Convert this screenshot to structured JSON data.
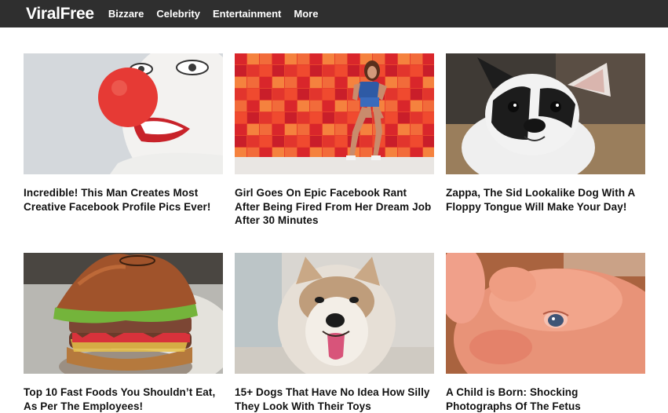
{
  "site": {
    "logo": "ViralFree",
    "nav": [
      "Bizzare",
      "Celebrity",
      "Entertainment",
      "More"
    ]
  },
  "articles": [
    {
      "title": "Incredible! This Man Creates Most Creative Facebook Profile Pics Ever!",
      "image": "clown-face-red-nose"
    },
    {
      "title": "Girl Goes On Epic Facebook Rant After Being Fired From Her Dream Job After 30 Minutes",
      "image": "woman-against-red-tile-wall"
    },
    {
      "title": "Zappa, The Sid Lookalike Dog With A Floppy Tongue Will Make Your Day!",
      "image": "french-bulldog-puppy"
    },
    {
      "title": "Top 10 Fast Foods You Shouldn’t Eat, As Per The Employees!",
      "image": "stacked-burger"
    },
    {
      "title": "15+ Dogs That Have No Idea How Silly They Look With Their Toys",
      "image": "husky-dog-tongue-out"
    },
    {
      "title": "A Child is Born: Shocking Photographs Of The Fetus",
      "image": "newborn-baby-closeup"
    }
  ],
  "colors": {
    "navbar": "#2f2f2f",
    "nav_text": "#ffffff",
    "title_text": "#111111"
  }
}
